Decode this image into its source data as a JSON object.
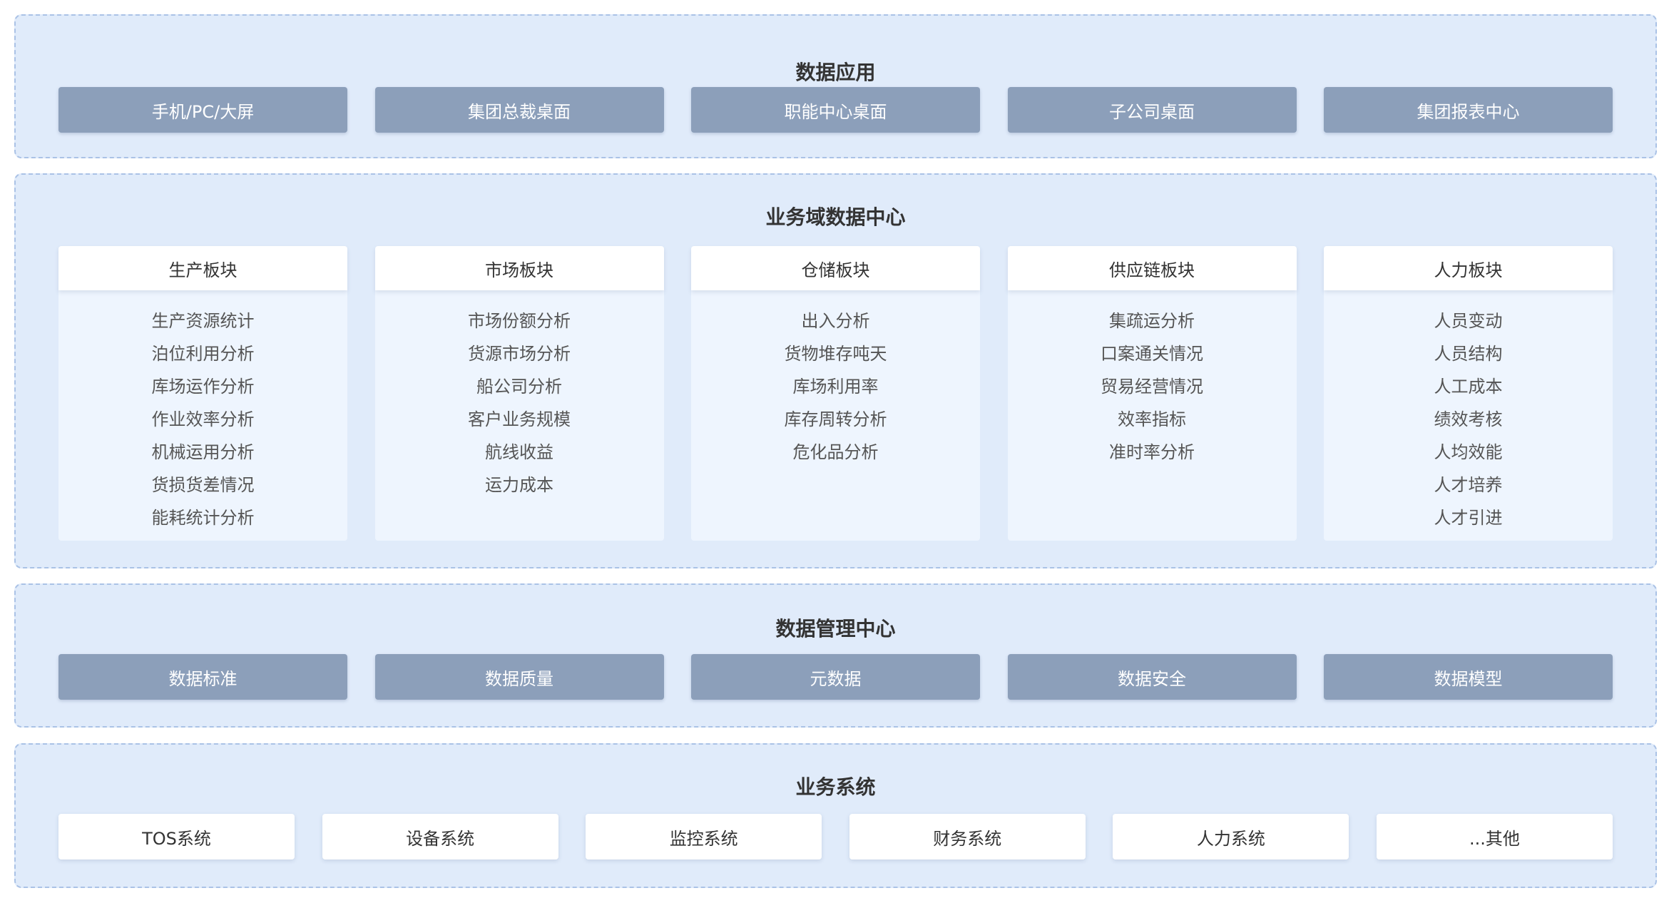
{
  "data_app": {
    "title": "数据应用",
    "items": [
      "手机/PC/大屏",
      "集团总裁桌面",
      "职能中心桌面",
      "子公司桌面",
      "集团报表中心"
    ]
  },
  "domain_center": {
    "title": "业务域数据中心",
    "blocks": [
      {
        "header": "生产板块",
        "items": [
          "生产资源统计",
          "泊位利用分析",
          "库场运作分析",
          "作业效率分析",
          "机械运用分析",
          "货损货差情况",
          "能耗统计分析"
        ]
      },
      {
        "header": "市场板块",
        "items": [
          "市场份额分析",
          "货源市场分析",
          "船公司分析",
          "客户业务规模",
          "航线收益",
          "运力成本"
        ]
      },
      {
        "header": "仓储板块",
        "items": [
          "出入分析",
          "货物堆存吨天",
          "库场利用率",
          "库存周转分析",
          "危化品分析"
        ]
      },
      {
        "header": "供应链板块",
        "items": [
          "集疏运分析",
          "口案通关情况",
          "贸易经营情况",
          "效率指标",
          "准时率分析"
        ]
      },
      {
        "header": "人力板块",
        "items": [
          "人员变动",
          "人员结构",
          "人工成本",
          "绩效考核",
          "人均效能",
          "人才培养",
          "人才引进"
        ]
      }
    ]
  },
  "data_mgmt": {
    "title": "数据管理中心",
    "items": [
      "数据标准",
      "数据质量",
      "元数据",
      "数据安全",
      "数据模型"
    ]
  },
  "biz_system": {
    "title": "业务系统",
    "items": [
      "TOS系统",
      "设备系统",
      "监控系统",
      "财务系统",
      "人力系统",
      "...其他"
    ]
  }
}
